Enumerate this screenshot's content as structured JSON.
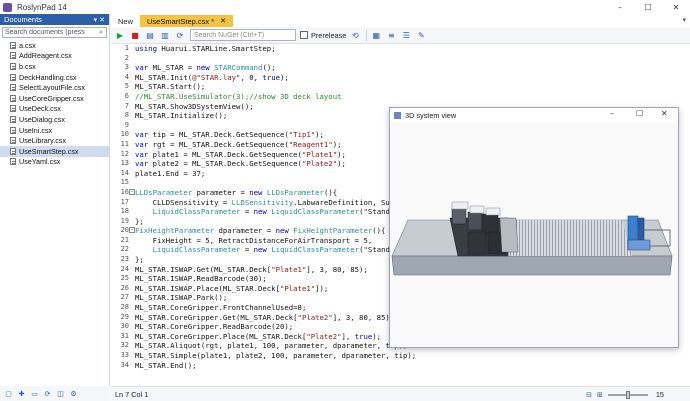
{
  "window": {
    "title": "RoslynPad 14",
    "min_icon": "minimize-icon",
    "max_icon": "maximize-icon",
    "close_icon": "close-icon"
  },
  "sidebar": {
    "header": "Documents",
    "search_placeholder": "Search documents (press",
    "files": [
      "a.csx",
      "AddReagent.csx",
      "b.csx",
      "DeckHandling.csx",
      "SelectLayoutFile.csx",
      "UseCoreGripper.csx",
      "UseDeck.csx",
      "UseDialog.csx",
      "UseIni.csx",
      "UseLibrary.csx",
      "UseSmartStep.csx",
      "UseYaml.csx"
    ],
    "selected": "UseSmartStep.csx"
  },
  "tabs": [
    {
      "label": "New"
    },
    {
      "label": "UseSmartStep.csx *",
      "active": true
    }
  ],
  "toolbar": {
    "nuget_placeholder": "Search NuGet (Ctrl+T)",
    "prerelease_label": "Prerelease"
  },
  "code": {
    "lines": [
      {
        "n": "1",
        "t": "using Huarui.STARLine.SmartStep;"
      },
      {
        "n": "2",
        "t": ""
      },
      {
        "n": "3",
        "t": "var ML_STAR = new STARCommand();"
      },
      {
        "n": "4",
        "t": "ML_STAR.Init(@\"STAR.lay\", 0, true);"
      },
      {
        "n": "5",
        "t": "ML_STAR.Start();"
      },
      {
        "n": "6",
        "t": "//ML_STAR.UseSimulator(3);//show 3D deck layout"
      },
      {
        "n": "7",
        "t": "ML_STAR.Show3DSystemView();"
      },
      {
        "n": "8",
        "t": "ML_STAR.Initialize();"
      },
      {
        "n": "9",
        "t": ""
      },
      {
        "n": "10",
        "t": "var tip = ML_STAR.Deck.GetSequence(\"Tip1\");"
      },
      {
        "n": "11",
        "t": "var rgt = ML_STAR.Deck.GetSequence(\"Reagent1\");"
      },
      {
        "n": "12",
        "t": "var plate1 = ML_STAR.Deck.GetSequence(\"Plate1\");"
      },
      {
        "n": "13",
        "t": "var plate2 = ML_STAR.Deck.GetSequence(\"Plate2\");"
      },
      {
        "n": "14",
        "t": "plate1.End = 37;"
      },
      {
        "n": "15",
        "t": ""
      },
      {
        "n": "16",
        "t": "LLDsParameter parameter = new LLDsParameter(){"
      },
      {
        "n": "17",
        "t": "    CLLDSensitivity = LLDSensitivity.LabwareDefinition, Sub"
      },
      {
        "n": "18",
        "t": "    LiquidClassParameter = new LiquidClassParameter(\"Standa"
      },
      {
        "n": "19",
        "t": "};"
      },
      {
        "n": "20",
        "t": "FixHeightParameter dparameter = new FixHeightParameter(){"
      },
      {
        "n": "21",
        "t": "    FixHeight = 5, RetractDistanceForAirTransport = 5,"
      },
      {
        "n": "22",
        "t": "    LiquidClassParameter = new LiquidClassParameter(\"Standa"
      },
      {
        "n": "23",
        "t": "};"
      },
      {
        "n": "24",
        "t": "ML_STAR.ISWAP.Get(ML_STAR.Deck[\"Plate1\"], 3, 80, 85);"
      },
      {
        "n": "25",
        "t": "ML_STAR.ISWAP.ReadBarcode(30);"
      },
      {
        "n": "26",
        "t": "ML_STAR.ISWAP.Place(ML_STAR.Deck[\"Plate1\"]);"
      },
      {
        "n": "27",
        "t": "ML_STAR.ISWAP.Park();"
      },
      {
        "n": "28",
        "t": "ML_STAR.CoreGripper.FrontChannelUsed=8;"
      },
      {
        "n": "29",
        "t": "ML_STAR.CoreGripper.Get(ML_STAR.Deck[\"Plate2\"], 3, 80, 85);"
      },
      {
        "n": "30",
        "t": "ML_STAR.CoreGripper.ReadBarcode(20);"
      },
      {
        "n": "31",
        "t": "ML_STAR.CoreGripper.Place(ML_STAR.Deck[\"Plate2\"], true);"
      },
      {
        "n": "32",
        "t": "ML_STAR.Aliquot(rgt, plate1, 100, parameter, dparameter, tip);"
      },
      {
        "n": "33",
        "t": "ML_STAR.Simple(plate1, plate2, 100, parameter, dparameter, tip);"
      },
      {
        "n": "34",
        "t": "ML_STAR.End();"
      }
    ]
  },
  "status": {
    "position": "Ln 7 Col 1",
    "zoom": "15"
  },
  "system_view": {
    "title": "3D system view"
  },
  "colors": {
    "accent": "#2d5fa8",
    "active_tab": "#f5c242"
  }
}
